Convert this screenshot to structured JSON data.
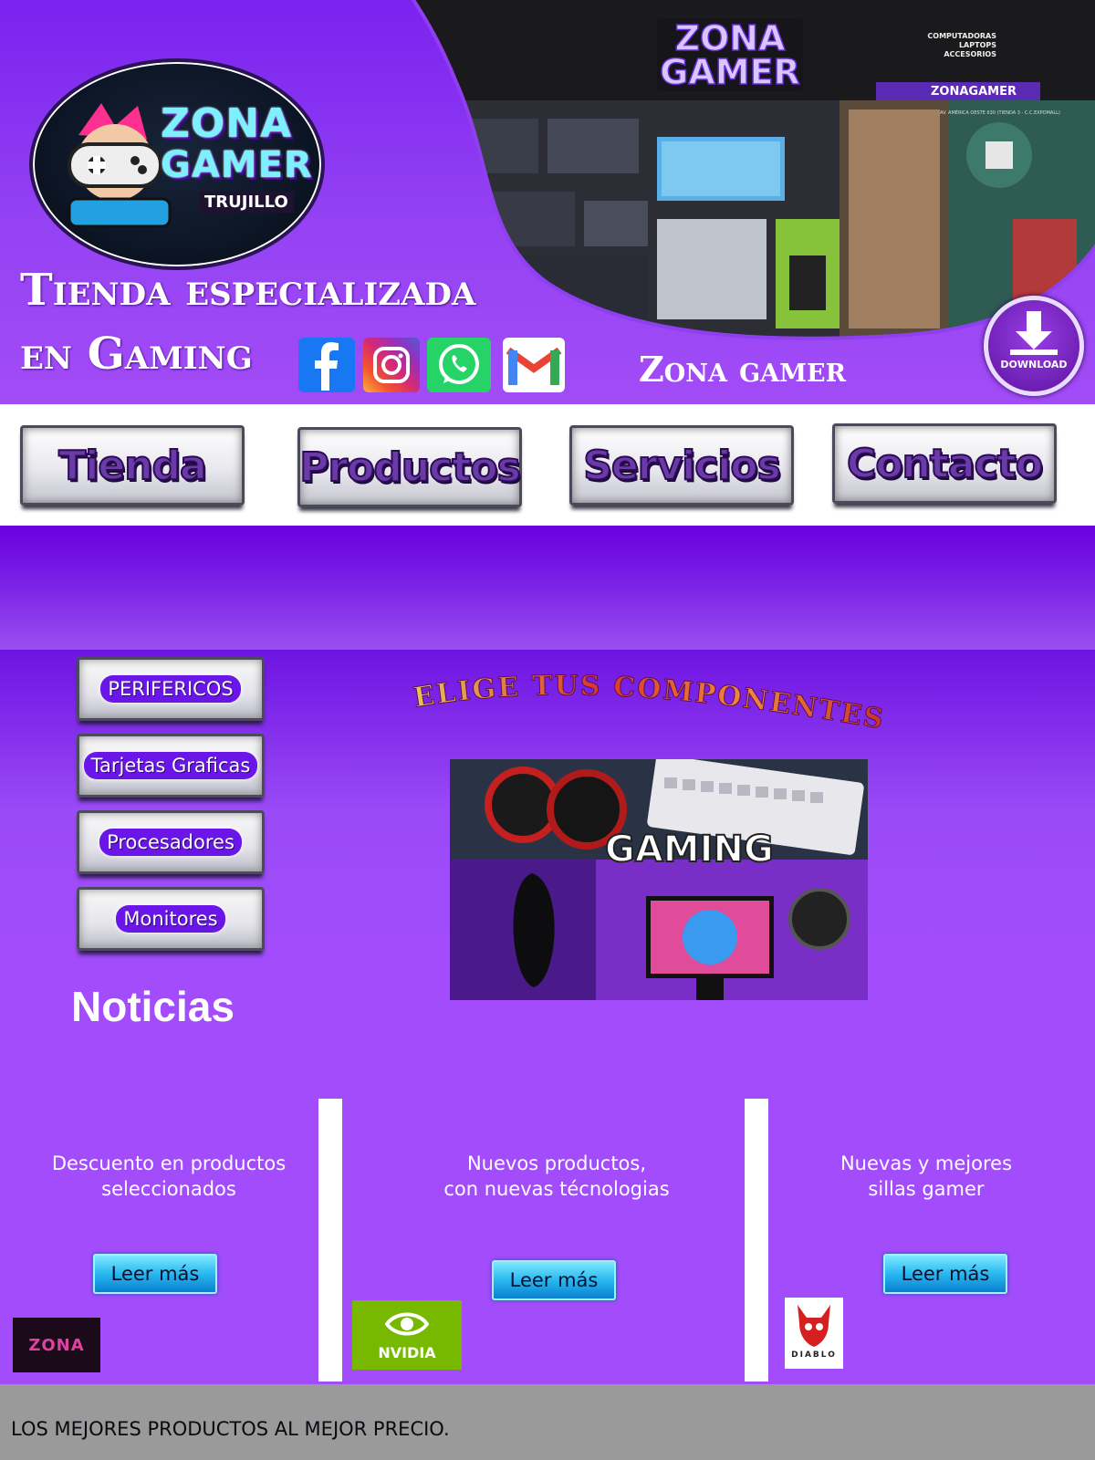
{
  "header": {
    "logo": {
      "title_line1": "ZONA",
      "title_line2": "GAMER",
      "city": "TRUJILLO"
    },
    "headline_line1": "Tienda especializada",
    "headline_line2": "en Gaming",
    "store_name": "Zona gamer",
    "store_photo": {
      "sign_line1": "ZONA",
      "sign_line2": "GAMER",
      "sign_services": [
        "COMPUTADORAS",
        "LAPTOPS",
        "ACCESORIOS"
      ],
      "social_handle": "ZONAGAMER",
      "address": "AV. AMÉRICA OESTE 630 (TIENDA 3 - C.C.EXPOMALL)"
    },
    "social_icons": [
      "facebook-icon",
      "instagram-icon",
      "whatsapp-icon",
      "gmail-icon"
    ],
    "download_label": "DOWNLOAD"
  },
  "nav": {
    "items": [
      {
        "label": "Tienda"
      },
      {
        "label": "Productos"
      },
      {
        "label": "Servicios"
      },
      {
        "label": "Contacto"
      }
    ]
  },
  "sidebar": {
    "items": [
      {
        "label": "PERIFERICOS"
      },
      {
        "label": "Tarjetas Graficas"
      },
      {
        "label": "Procesadores"
      },
      {
        "label": "Monitores"
      }
    ],
    "news_heading": "Noticias"
  },
  "main": {
    "elige_title": "ELIGE TUS COMPONENTES",
    "gaming_banner_text": "GAMING"
  },
  "cards": [
    {
      "text_line1": "Descuento en productos",
      "text_line2": "seleccionados",
      "button": "Leer más",
      "logo": "ZONA"
    },
    {
      "text_line1": "Nuevos productos,",
      "text_line2": "con nuevas técnologias",
      "button": "Leer más",
      "logo": "NVIDIA"
    },
    {
      "text_line1": "Nuevas y mejores",
      "text_line2": "sillas gamer",
      "button": "Leer más",
      "logo": "DIABLO"
    }
  ],
  "footer": {
    "text": "LOS MEJORES PRODUCTOS AL MEJOR PRECIO."
  },
  "colors": {
    "purple_bg": "#a24cfb",
    "deep_purple": "#6b00e0",
    "button_blue": "#28b8f0",
    "footer_gray": "#9a9a9a"
  }
}
